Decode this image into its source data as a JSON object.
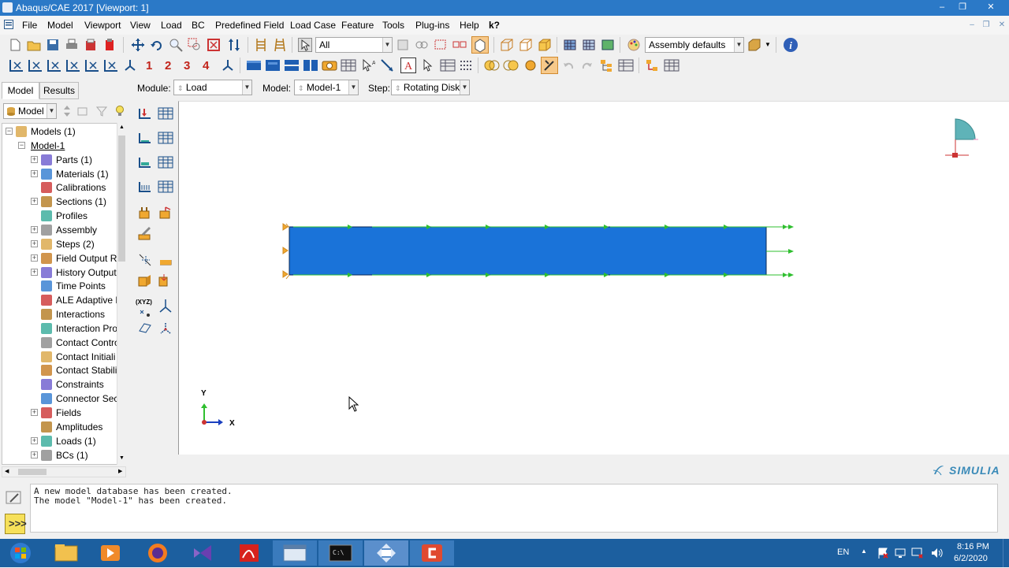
{
  "window": {
    "title": "Abaqus/CAE 2017 [Viewport: 1]",
    "controls": [
      "–",
      "❐",
      "✕"
    ]
  },
  "menubar": {
    "items": [
      "File",
      "Model",
      "Viewport",
      "View",
      "Load",
      "BC",
      "Predefined Field",
      "Load Case",
      "Feature",
      "Tools",
      "Plug-ins",
      "Help",
      "k?"
    ]
  },
  "toolbar": {
    "selection_filter": "All",
    "render_style": "Assembly defaults",
    "numbers": [
      "1",
      "2",
      "3",
      "4"
    ]
  },
  "context": {
    "module_label": "Module:",
    "module_value": "Load",
    "model_label": "Model:",
    "model_value": "Model-1",
    "step_label": "Step:",
    "step_value": "Rotating Disk"
  },
  "tabs": [
    "Model",
    "Results"
  ],
  "tree": {
    "selector": "Model",
    "items": [
      {
        "label": "Models (1)",
        "indent": 0,
        "exp": "−",
        "icon": "models-icon"
      },
      {
        "label": "Model-1",
        "indent": 1,
        "exp": "−",
        "icon": ""
      },
      {
        "label": "Parts (1)",
        "indent": 2,
        "exp": "+",
        "icon": "parts-icon"
      },
      {
        "label": "Materials (1)",
        "indent": 2,
        "exp": "+",
        "icon": "materials-icon"
      },
      {
        "label": "Calibrations",
        "indent": 2,
        "exp": "",
        "icon": "calibrations-icon"
      },
      {
        "label": "Sections (1)",
        "indent": 2,
        "exp": "+",
        "icon": "sections-icon"
      },
      {
        "label": "Profiles",
        "indent": 2,
        "exp": "",
        "icon": "profiles-icon"
      },
      {
        "label": "Assembly",
        "indent": 2,
        "exp": "+",
        "icon": "assembly-icon"
      },
      {
        "label": "Steps (2)",
        "indent": 2,
        "exp": "+",
        "icon": "steps-icon"
      },
      {
        "label": "Field Output Re",
        "indent": 2,
        "exp": "+",
        "icon": "field-output-icon"
      },
      {
        "label": "History Output",
        "indent": 2,
        "exp": "+",
        "icon": "history-output-icon"
      },
      {
        "label": "Time Points",
        "indent": 2,
        "exp": "",
        "icon": "time-points-icon"
      },
      {
        "label": "ALE Adaptive M",
        "indent": 2,
        "exp": "",
        "icon": "ale-icon"
      },
      {
        "label": "Interactions",
        "indent": 2,
        "exp": "",
        "icon": "interactions-icon"
      },
      {
        "label": "Interaction Pro",
        "indent": 2,
        "exp": "",
        "icon": "interaction-properties-icon"
      },
      {
        "label": "Contact Contro",
        "indent": 2,
        "exp": "",
        "icon": "contact-controls-icon"
      },
      {
        "label": "Contact Initiali",
        "indent": 2,
        "exp": "",
        "icon": "contact-init-icon"
      },
      {
        "label": "Contact Stabili",
        "indent": 2,
        "exp": "",
        "icon": "contact-stab-icon"
      },
      {
        "label": "Constraints",
        "indent": 2,
        "exp": "",
        "icon": "constraints-icon"
      },
      {
        "label": "Connector Sect",
        "indent": 2,
        "exp": "",
        "icon": "connector-icon"
      },
      {
        "label": "Fields",
        "indent": 2,
        "exp": "+",
        "icon": "fields-icon"
      },
      {
        "label": "Amplitudes",
        "indent": 2,
        "exp": "",
        "icon": "amplitudes-icon"
      },
      {
        "label": "Loads (1)",
        "indent": 2,
        "exp": "+",
        "icon": "loads-icon"
      },
      {
        "label": "BCs (1)",
        "indent": 2,
        "exp": "+",
        "icon": "bcs-icon"
      }
    ]
  },
  "toolbox": {
    "xyz_label": "(XYZ)"
  },
  "viewport": {
    "axis_x": "X",
    "axis_y": "Y",
    "brand": "SIMULIA",
    "part_color": "#1a73d9",
    "arrow_color": "#2fbf2f"
  },
  "messages": [
    "A new model database has been created.",
    "The model \"Model-1\" has been created."
  ],
  "taskbar": {
    "lang": "EN",
    "time": "8:16 PM",
    "date": "6/2/2020"
  }
}
